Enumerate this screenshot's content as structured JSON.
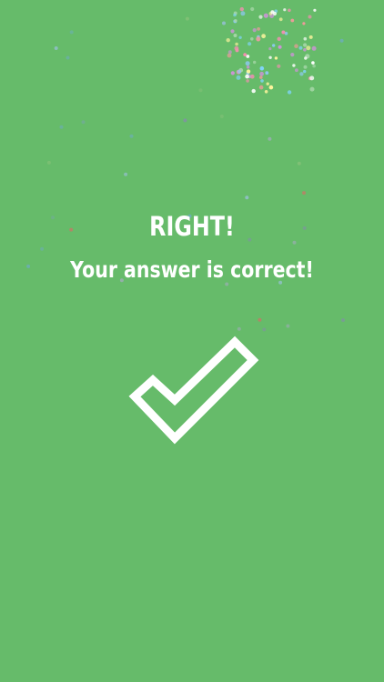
{
  "result": {
    "title": "RIGHT!",
    "message": "Your answer is correct!"
  },
  "icons": {
    "check": "check-icon"
  },
  "colors": {
    "background": "#66bb6a",
    "text": "#ffffff",
    "confetti": [
      "#f48fb1",
      "#ffffff",
      "#81d4fa",
      "#fff59d",
      "#ce93d8",
      "#a5d6a7",
      "#ef9a9a",
      "#90caf9"
    ]
  }
}
